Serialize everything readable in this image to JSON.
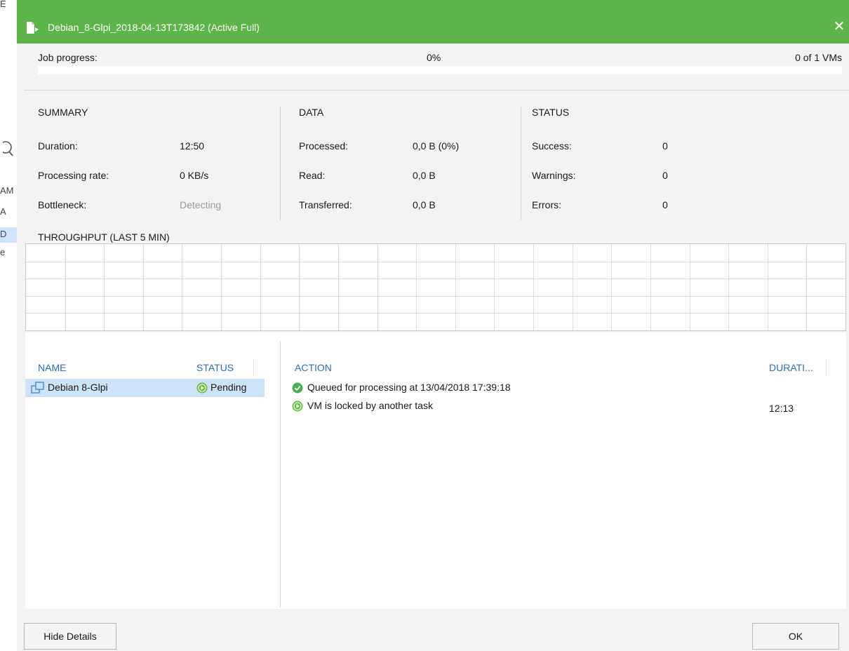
{
  "background_window": {
    "fragments": [
      "E",
      "AM",
      "A",
      "D",
      "e"
    ]
  },
  "dialog": {
    "title": "Debian_8-Glpi_2018-04-13T173842 (Active Full)",
    "close_glyph": "✕"
  },
  "progress": {
    "label": "Job progress:",
    "percent_text": "0%",
    "percent_value": 0,
    "vms_text": "0 of 1 VMs"
  },
  "summary": {
    "heading": "SUMMARY",
    "rows": [
      {
        "label": "Duration:",
        "value": "12:50"
      },
      {
        "label": "Processing rate:",
        "value": "0 KB/s"
      },
      {
        "label": "Bottleneck:",
        "value": "Detecting"
      }
    ]
  },
  "data_section": {
    "heading": "DATA",
    "rows": [
      {
        "label": "Processed:",
        "value": "0,0 B (0%)"
      },
      {
        "label": "Read:",
        "value": "0,0 B"
      },
      {
        "label": "Transferred:",
        "value": "0,0 B"
      }
    ]
  },
  "status_section": {
    "heading": "STATUS",
    "rows": [
      {
        "label": "Success:",
        "value": "0"
      },
      {
        "label": "Warnings:",
        "value": "0"
      },
      {
        "label": "Errors:",
        "value": "0"
      }
    ]
  },
  "throughput": {
    "title": "THROUGHPUT (LAST 5 MIN)"
  },
  "vm_list": {
    "columns": [
      "NAME",
      "STATUS"
    ],
    "rows": [
      {
        "name": "Debian 8-Glpi",
        "status": "Pending",
        "icon": "vm-icon"
      }
    ]
  },
  "action_log": {
    "columns": [
      "ACTION",
      "DURATI..."
    ],
    "rows": [
      {
        "icon": "success-check-icon",
        "text": "Queued for processing at 13/04/2018 17:39:18",
        "duration": ""
      },
      {
        "icon": "pending-play-icon",
        "text": "VM is locked by another task",
        "duration": "12:13"
      }
    ]
  },
  "buttons": {
    "hide_details": "Hide Details",
    "ok": "OK"
  },
  "colors": {
    "title_bar": "#5db549",
    "column_header": "#2b6fb5",
    "selection": "#cde3f8",
    "pending": "#6cbf43",
    "success": "#4caf50"
  }
}
